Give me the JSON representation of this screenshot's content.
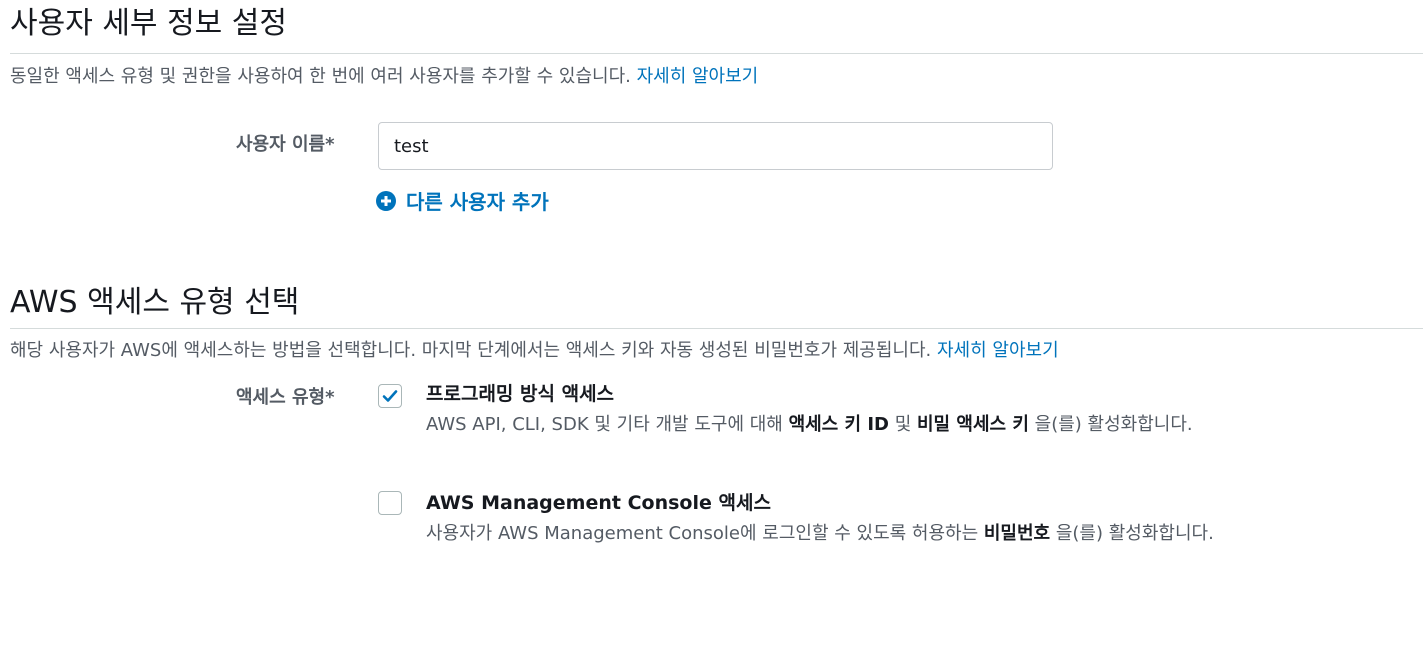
{
  "user_details": {
    "title": "사용자 세부 정보 설정",
    "description": "동일한 액세스 유형 및 권한을 사용하여 한 번에 여러 사용자를 추가할 수 있습니다.",
    "learn_more": "자세히 알아보기",
    "username_label": "사용자 이름*",
    "username_value": "test",
    "add_user_label": "다른 사용자 추가",
    "add_user_icon": "plus-circle-icon"
  },
  "access_type": {
    "title": "AWS 액세스 유형 선택",
    "description": "해당 사용자가 AWS에 액세스하는 방법을 선택합니다. 마지막 단계에서는 액세스 키와 자동 생성된 비밀번호가 제공됩니다.",
    "learn_more": "자세히 알아보기",
    "field_label": "액세스 유형*",
    "options": [
      {
        "title": "프로그래밍 방식 액세스",
        "checked": true,
        "desc_prefix": "AWS API, CLI, SDK 및 기타 개발 도구에 대해 ",
        "desc_bold1": "액세스 키 ID",
        "desc_mid": " 및 ",
        "desc_bold2": "비밀 액세스 키",
        "desc_suffix": " 을(를) 활성화합니다."
      },
      {
        "title": "AWS Management Console 액세스",
        "checked": false,
        "desc_prefix": "사용자가 AWS Management Console에 로그인할 수 있도록 허용하는 ",
        "desc_bold1": "비밀번호",
        "desc_suffix": " 을(를) 활성화합니다."
      }
    ]
  },
  "colors": {
    "link": "#0073bb",
    "checkbox_check": "#0073bb",
    "divider": "#d5dbdb"
  }
}
